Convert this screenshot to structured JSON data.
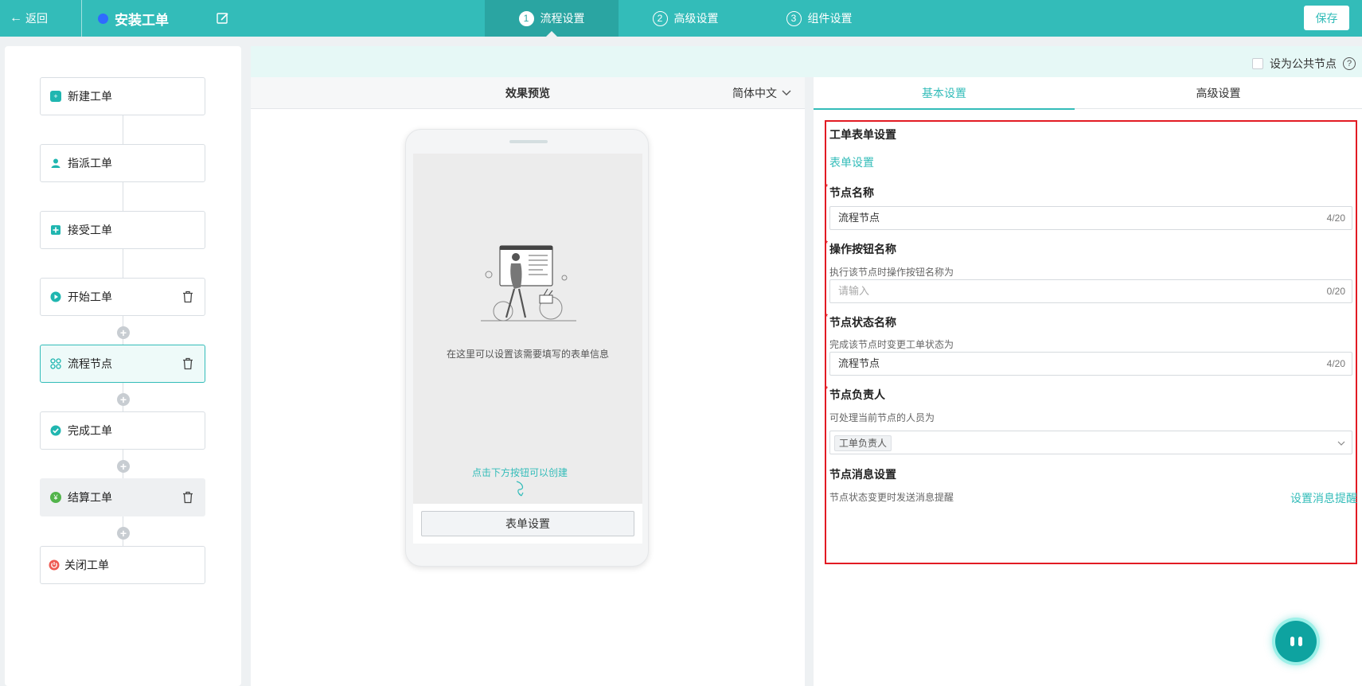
{
  "header": {
    "back_label": "返回",
    "app_title": "安装工单",
    "steps": [
      {
        "num": "1",
        "label": "流程设置"
      },
      {
        "num": "2",
        "label": "高级设置"
      },
      {
        "num": "3",
        "label": "组件设置"
      }
    ],
    "save_label": "保存",
    "accent_color": "#33bcb9"
  },
  "flow": {
    "nodes": [
      {
        "label": "新建工单",
        "icon": "file-plus-icon"
      },
      {
        "label": "指派工单",
        "icon": "user-icon"
      },
      {
        "label": "接受工单",
        "icon": "accept-icon"
      },
      {
        "label": "开始工单",
        "icon": "play-icon"
      },
      {
        "label": "流程节点",
        "icon": "nodes-icon"
      },
      {
        "label": "完成工单",
        "icon": "check-circle-icon"
      },
      {
        "label": "结算工单",
        "icon": "yen-icon"
      },
      {
        "label": "关闭工单",
        "icon": "power-icon"
      }
    ],
    "active_node": "流程节点"
  },
  "public_node_label": "设为公共节点",
  "help_glyph": "?",
  "preview": {
    "title": "效果预览",
    "language": "简体中文",
    "empty_text": "在这里可以设置该需要填写的表单信息",
    "hint_text": "点击下方按钮可以创建",
    "form_button": "表单设置"
  },
  "settings": {
    "tabs": [
      "基本设置",
      "高级设置"
    ],
    "form_section_title": "工单表单设置",
    "form_link": "表单设置",
    "node_name_label": "节点名称",
    "node_name_value": "流程节点",
    "node_name_count": "4/20",
    "button_name_label": "操作按钮名称",
    "button_name_desc": "执行该节点时操作按钮名称为",
    "button_name_placeholder": "请输入",
    "button_name_count": "0/20",
    "status_label": "节点状态名称",
    "status_desc": "完成该节点时变更工单状态为",
    "status_value": "流程节点",
    "status_count": "4/20",
    "owner_label": "节点负责人",
    "owner_desc": "可处理当前节点的人员为",
    "owner_tag": "工单负责人",
    "msg_label": "节点消息设置",
    "msg_desc": "节点状态变更时发送消息提醒",
    "msg_link": "设置消息提醒"
  }
}
